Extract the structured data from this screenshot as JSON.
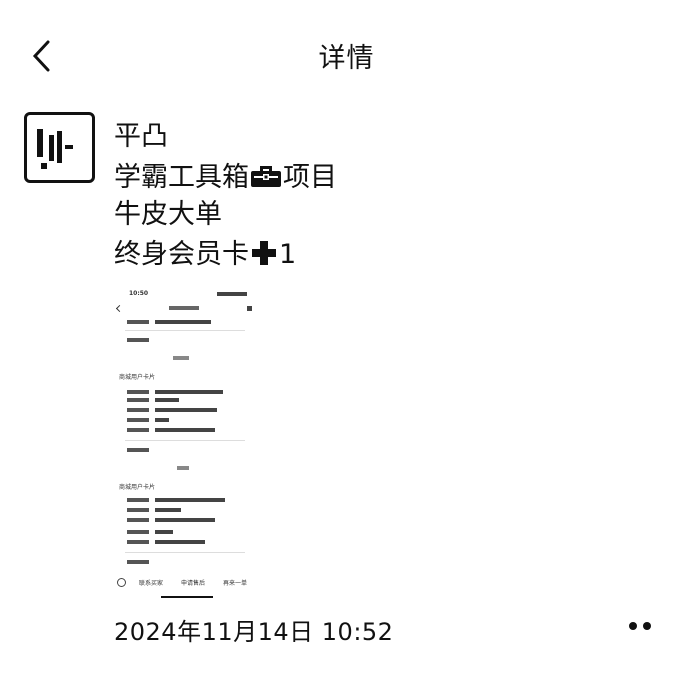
{
  "header": {
    "title": "详情"
  },
  "post": {
    "lines": [
      "学霸工具箱",
      "项目",
      "牛皮大单",
      "终身会员卡",
      "1"
    ],
    "name": "平凸",
    "timestamp": "2024年11月14日 10:52"
  },
  "icons": {
    "back": "chevron-left-icon",
    "toolbox": "toolbox-icon",
    "plus": "plus-icon",
    "more": "more-dots-icon"
  },
  "screenshot": {
    "time": "10:50",
    "section_1_title": "商城用户卡片",
    "section_2_title": "商城用户卡片",
    "bottom_tabs": [
      "联系买家",
      "申请售后",
      "再来一单"
    ]
  }
}
